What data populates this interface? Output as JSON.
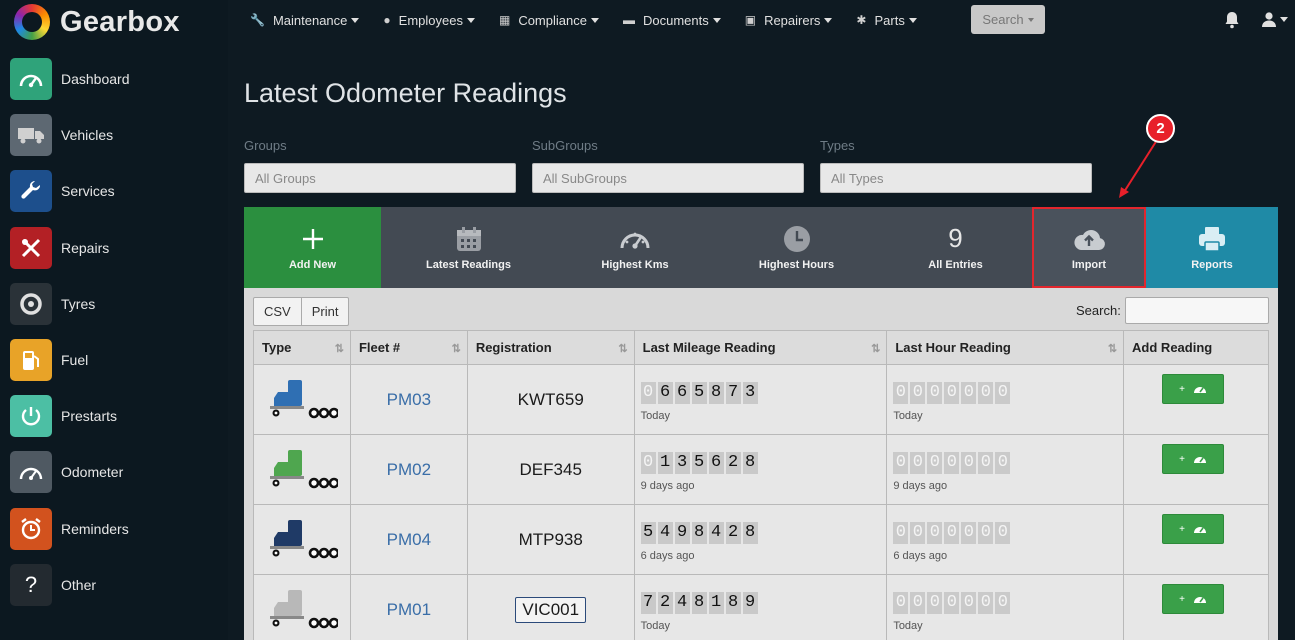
{
  "app": {
    "name": "Gearbox"
  },
  "sidebar": {
    "items": [
      {
        "label": "Dashboard",
        "icon": "gauge-icon",
        "color": "#2fa37a"
      },
      {
        "label": "Vehicles",
        "icon": "truck-icon",
        "color": "#5d6872"
      },
      {
        "label": "Services",
        "icon": "wrench-icon",
        "color": "#1d4f8c"
      },
      {
        "label": "Repairs",
        "icon": "tools-icon",
        "color": "#b32025"
      },
      {
        "label": "Tyres",
        "icon": "tyre-icon",
        "color": "#2a3238"
      },
      {
        "label": "Fuel",
        "icon": "fuel-icon",
        "color": "#e8a328"
      },
      {
        "label": "Prestarts",
        "icon": "power-icon",
        "color": "#4cbfa4"
      },
      {
        "label": "Odometer",
        "icon": "odometer-icon",
        "color": "#4f5962"
      },
      {
        "label": "Reminders",
        "icon": "alarm-clock-icon",
        "color": "#d2521e"
      },
      {
        "label": "Other",
        "icon": "question-icon",
        "color": "#232a30"
      }
    ]
  },
  "nav": {
    "items": [
      {
        "label": "Maintenance",
        "icon": "wrench-icon"
      },
      {
        "label": "Employees",
        "icon": "user-circle-icon"
      },
      {
        "label": "Compliance",
        "icon": "calendar-icon"
      },
      {
        "label": "Documents",
        "icon": "folder-icon"
      },
      {
        "label": "Repairers",
        "icon": "id-card-icon"
      },
      {
        "label": "Parts",
        "icon": "gear-icon"
      }
    ],
    "search_label": "Search"
  },
  "page": {
    "title": "Latest Odometer Readings",
    "filters": [
      {
        "label": "Groups",
        "value": "All Groups"
      },
      {
        "label": "SubGroups",
        "value": "All SubGroups"
      },
      {
        "label": "Types",
        "value": "All Types"
      }
    ]
  },
  "tiles": [
    {
      "label": "Add New",
      "icon": "plus-icon",
      "color": "#2b8f3f"
    },
    {
      "label": "Latest Readings",
      "icon": "calendar-icon",
      "color": "#434a53"
    },
    {
      "label": "Highest Kms",
      "icon": "speedometer-icon",
      "color": "#434a53"
    },
    {
      "label": "Highest Hours",
      "icon": "clock-icon",
      "color": "#434a53"
    },
    {
      "label": "All Entries",
      "count": "9",
      "color": "#434a53"
    },
    {
      "label": "Import",
      "icon": "cloud-upload-icon",
      "color": "#4a525c"
    },
    {
      "label": "Reports",
      "icon": "printer-icon",
      "color": "#1f8aa6"
    }
  ],
  "toolbar": {
    "csv_label": "CSV",
    "print_label": "Print",
    "search_label": "Search:"
  },
  "table": {
    "headers": [
      "Type",
      "Fleet #",
      "Registration",
      "Last Mileage Reading",
      "Last Hour Reading",
      "Add Reading"
    ],
    "rows": [
      {
        "truck_color": "#2f6fb3",
        "fleet": "PM03",
        "registration": "KWT659",
        "mileage": "0665873",
        "mileage_lead_zeros": 1,
        "mileage_age": "Today",
        "hours": "0000000",
        "hours_age": "Today"
      },
      {
        "truck_color": "#4fa64f",
        "fleet": "PM02",
        "registration": "DEF345",
        "mileage": "0135628",
        "mileage_lead_zeros": 1,
        "mileage_age": "9 days ago",
        "hours": "0000000",
        "hours_age": "9 days ago"
      },
      {
        "truck_color": "#1f3a66",
        "fleet": "PM04",
        "registration": "MTP938",
        "mileage": "5498428",
        "mileage_lead_zeros": 0,
        "mileage_age": "6 days ago",
        "hours": "0000000",
        "hours_age": "6 days ago"
      },
      {
        "truck_color": "#b8b8b8",
        "fleet": "PM01",
        "registration": "VIC001",
        "mileage": "7248189",
        "mileage_lead_zeros": 0,
        "mileage_age": "Today",
        "hours": "0000000",
        "hours_age": "Today"
      }
    ],
    "add_label": "+"
  },
  "annotation": {
    "step": "2",
    "color": "#e8202a"
  }
}
